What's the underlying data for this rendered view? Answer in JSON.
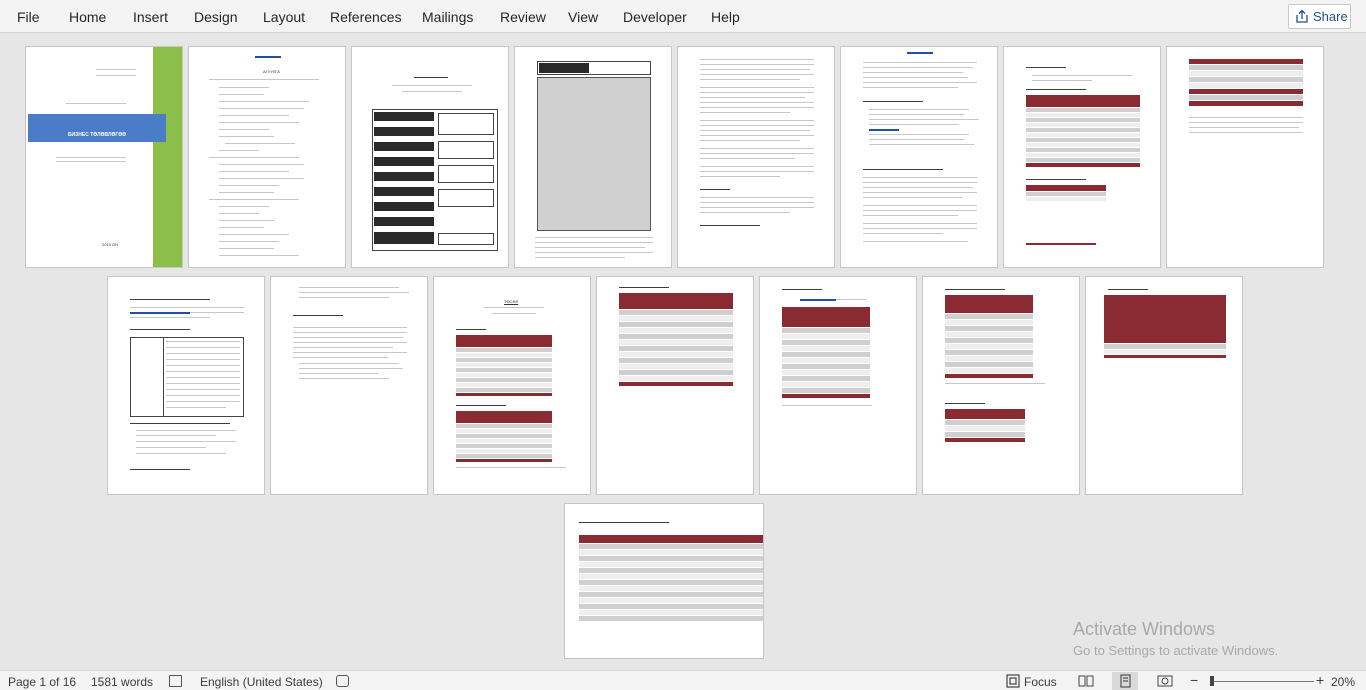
{
  "menu": {
    "tabs": [
      "File",
      "Home",
      "Insert",
      "Design",
      "Layout",
      "References",
      "Mailings",
      "Review",
      "View",
      "Developer",
      "Help"
    ],
    "share_label": "Share",
    "share_icon": "share-icon"
  },
  "document": {
    "cover_title": "БИЗНЕС ТӨЛӨВЛӨГӨӨ",
    "cover_year": "2019 ОН",
    "toc_heading": "АГУУЛГА",
    "section_heading": "ТӨСӨЛ",
    "chart_caption": "Хүснэгт",
    "colors": {
      "table_header": "#8a2b33",
      "cover_band": "#4a7cc7",
      "cover_green": "#8cbf4a"
    }
  },
  "watermark": {
    "title": "Activate Windows",
    "subtitle": "Go to Settings to activate Windows."
  },
  "status": {
    "page": "Page 1 of 16",
    "words": "1581 words",
    "language": "English (United States)",
    "focus": "Focus",
    "zoom": "20%",
    "zoom_minus": "−",
    "zoom_plus": "+"
  }
}
